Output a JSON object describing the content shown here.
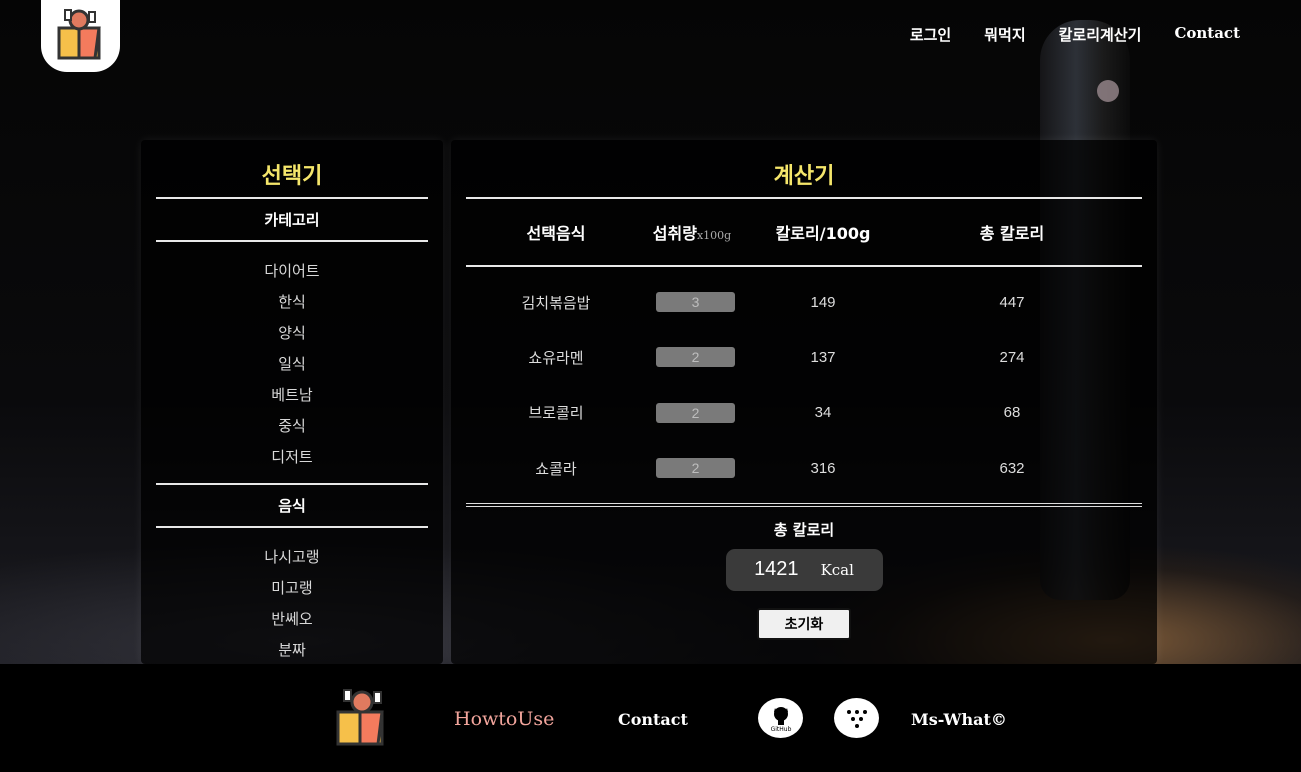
{
  "header": {
    "logo_icon": "food-box-icon",
    "nav": [
      "로그인",
      "뭐먹지",
      "칼로리계산기",
      "Contact"
    ]
  },
  "selector": {
    "title": "선택기",
    "category_title": "카테고리",
    "categories": [
      "다이어트",
      "한식",
      "양식",
      "일식",
      "베트남",
      "중식",
      "디저트"
    ],
    "food_title": "음식",
    "foods": [
      "나시고랭",
      "미고랭",
      "반쎄오",
      "분짜"
    ]
  },
  "calculator": {
    "title": "계산기",
    "columns": {
      "food": "선택음식",
      "amount": "섭취량",
      "amount_unit": "x100g",
      "per100": "칼로리/100g",
      "total": "총 칼로리"
    },
    "rows": [
      {
        "food": "김치볶음밥",
        "qty": "3",
        "per100": "149",
        "total": "447"
      },
      {
        "food": "쇼유라멘",
        "qty": "2",
        "per100": "137",
        "total": "274"
      },
      {
        "food": "브로콜리",
        "qty": "2",
        "per100": "34",
        "total": "68"
      },
      {
        "food": "쇼콜라",
        "qty": "2",
        "per100": "316",
        "total": "632"
      }
    ],
    "total_label": "총 칼로리",
    "total_value": "1421",
    "total_unit": "Kcal",
    "reset_label": "초기화"
  },
  "footer": {
    "howto": "HowtoUse",
    "contact": "Contact",
    "github_icon": "github-icon",
    "dots_icon": "dots-icon",
    "copyright": "Ms-What©"
  },
  "colors": {
    "accent_title": "#f5e66b",
    "howto_link": "#f2a59c"
  }
}
